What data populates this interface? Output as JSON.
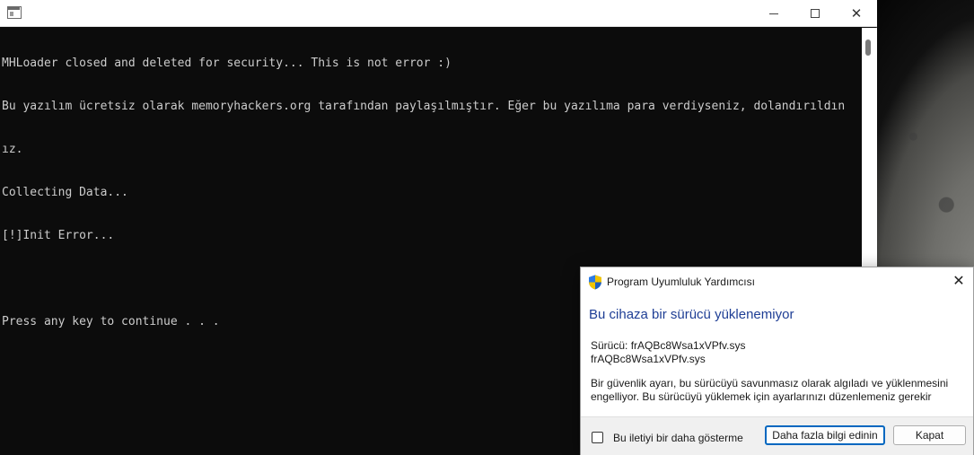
{
  "console": {
    "lines": [
      "MHLoader closed and deleted for security... This is not error :)",
      "Bu yazılım ücretsiz olarak memoryhackers.org tarafından paylaşılmıştır. Eğer bu yazılıma para verdiyseniz, dolandırıldın",
      "ız.",
      "Collecting Data...",
      "[!]Init Error...",
      "",
      "Press any key to continue . . ."
    ]
  },
  "window_controls": {
    "minimize": "minimize-icon",
    "maximize": "maximize-icon",
    "close": "close-icon",
    "close_glyph": "✕"
  },
  "dialog": {
    "title": "Program Uyumluluk Yardımcısı",
    "close_glyph": "✕",
    "heading": "Bu cihaza bir sürücü yüklenemiyor",
    "driver_line1": "Sürücü: frAQBc8Wsa1xVPfv.sys",
    "driver_line2": "frAQBc8Wsa1xVPfv.sys",
    "message_line1": "Bir güvenlik ayarı, bu sürücüyü savunmasız olarak algıladı ve yüklenmesini",
    "message_line2": "engelliyor. Bu sürücüyü yüklemek için ayarlarınızı düzenlemeniz gerekir",
    "checkbox_label": "Bu iletiyi bir daha gösterme",
    "checkbox_checked": false,
    "more_info_button": "Daha fazla bilgi edinin",
    "close_button": "Kapat",
    "icon": "shield-icon",
    "accent_color": "#0067c0",
    "heading_color": "#1e3e95"
  }
}
